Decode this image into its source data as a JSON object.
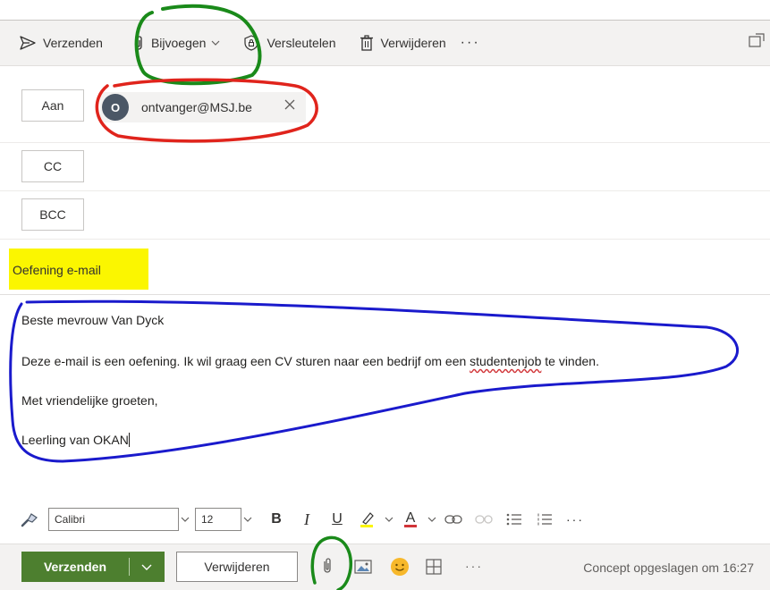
{
  "toolbar": {
    "send_label": "Verzenden",
    "attach_label": "Bijvoegen",
    "encrypt_label": "Versleutelen",
    "delete_label": "Verwijderen",
    "more_label": "···"
  },
  "recipients": {
    "to_label": "Aan",
    "cc_label": "CC",
    "bcc_label": "BCC",
    "to_chip": {
      "initial": "O",
      "email": "ontvanger@MSJ.be"
    }
  },
  "subject": {
    "value": "Oefening e-mail"
  },
  "body": {
    "greeting": "Beste mevrouw Van Dyck",
    "line2_before": "Deze e-mail is een oefening. Ik wil graag een CV sturen naar een bedrijf om een ",
    "line2_misspelled": "studentenjob",
    "line2_after": " te vinden.",
    "closing": "Met vriendelijke groeten,",
    "signature": "Leerling van OKAN"
  },
  "format_bar": {
    "font_name": "Calibri",
    "font_size": "12",
    "bold": "B",
    "italic": "I",
    "underline": "U",
    "font_color": "A",
    "more": "···"
  },
  "action_bar": {
    "send_label": "Verzenden",
    "discard_label": "Verwijderen",
    "more": "···",
    "status": "Concept opgeslagen om 16:27"
  },
  "colors": {
    "accent_green": "#4d7f2f",
    "highlight_yellow": "#fbf600",
    "annotation_green": "#1a8a1a",
    "annotation_red": "#e0241c",
    "annotation_blue": "#1a1acc"
  }
}
